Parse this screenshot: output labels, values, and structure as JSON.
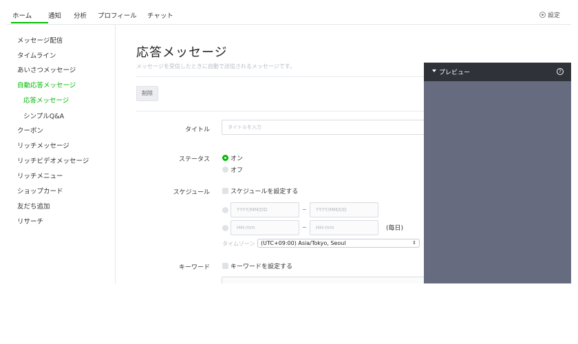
{
  "nav": {
    "tabs": [
      "ホーム",
      "通知",
      "分析",
      "プロフィール",
      "チャット"
    ],
    "settings_label": "設定",
    "settings_icon": "gear-icon",
    "accent_color": "#00b900"
  },
  "sidebar": {
    "items": [
      {
        "label": "メッセージ配信"
      },
      {
        "label": "タイムライン"
      },
      {
        "label": "あいさつメッセージ"
      },
      {
        "label": "自動応答メッセージ"
      },
      {
        "label": "応答メッセージ"
      },
      {
        "label": "シンプルQ&A"
      },
      {
        "label": "クーポン"
      },
      {
        "label": "リッチメッセージ"
      },
      {
        "label": "リッチビデオメッセージ"
      },
      {
        "label": "リッチメニュー"
      },
      {
        "label": "ショップカード"
      },
      {
        "label": "友だち追加"
      },
      {
        "label": "リサーチ"
      }
    ]
  },
  "main": {
    "title": "応答メッセージ",
    "description": "メッセージを受信したときに自動で送信されるメッセージです。",
    "delete_button": "削除",
    "form": {
      "title_label": "タイトル",
      "title_placeholder": "タイトルを入力",
      "status_label": "ステータス",
      "status_on": "オン",
      "status_off": "オフ",
      "schedule_label": "スケジュール",
      "schedule_checkbox": "スケジュールを設定する",
      "date_from_placeholder": "YYYY/MM/DD",
      "date_to_placeholder": "YYYY/MM/DD",
      "time_from_placeholder": "HH:mm",
      "time_to_placeholder": "HH:mm",
      "tilde": "~",
      "daily": "(毎日)",
      "timezone_label": "タイムゾーン :",
      "timezone_value": "(UTC+09:00) Asia/Tokyo, Seoul",
      "keyword_label": "キーワード",
      "keyword_checkbox": "キーワードを設定する"
    }
  },
  "preview": {
    "title": "プレビュー",
    "help_icon": "help-icon",
    "help_glyph": "?"
  }
}
